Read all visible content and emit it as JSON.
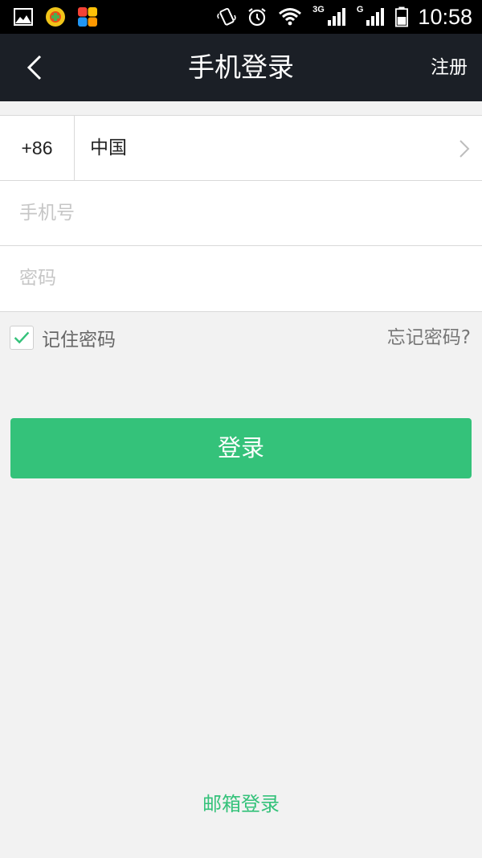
{
  "status_bar": {
    "time": "10:58",
    "net_3g": "3G",
    "net_g": "G",
    "left_icons": [
      "gallery-icon",
      "app-icon",
      "app-grid-icon"
    ],
    "right_icons": [
      "vibrate-icon",
      "alarm-icon",
      "wifi-icon",
      "signal-3g-icon",
      "signal-g-icon",
      "battery-icon"
    ]
  },
  "header": {
    "title": "手机登录",
    "register_label": "注册",
    "back_icon": "back-arrow-icon"
  },
  "form": {
    "country_code": "+86",
    "country_name": "中国",
    "phone_placeholder": "手机号",
    "password_placeholder": "密码"
  },
  "options": {
    "remember_label": "记住密码",
    "remember_checked": true,
    "forgot_label": "忘记密码?"
  },
  "login_button": "登录",
  "email_login": "邮箱登录",
  "colors": {
    "accent": "#34c27a",
    "titlebar": "#1b1f26",
    "background": "#f2f2f2"
  }
}
